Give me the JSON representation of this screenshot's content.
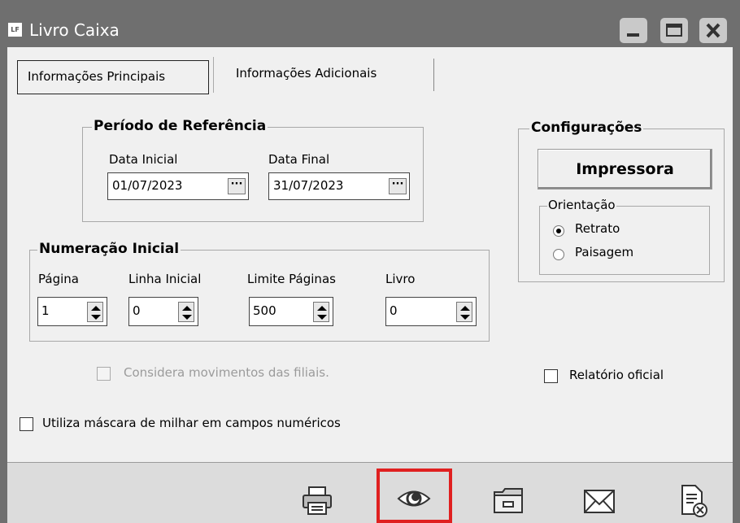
{
  "window": {
    "title": "Livro Caixa",
    "app_icon": "LF"
  },
  "tabs": [
    {
      "label": "Informações Principais",
      "active": true
    },
    {
      "label": "Informações Adicionais",
      "active": false
    }
  ],
  "periodo": {
    "legend": "Período de Referência",
    "data_inicial_label": "Data Inicial",
    "data_inicial": "01/07/2023",
    "data_final_label": "Data Final",
    "data_final": "31/07/2023",
    "picker_label": "···"
  },
  "numeracao": {
    "legend": "Numeração Inicial",
    "fields": [
      {
        "label": "Página",
        "value": "1"
      },
      {
        "label": "Linha Inicial",
        "value": "0"
      },
      {
        "label": "Limite Páginas",
        "value": "500"
      },
      {
        "label": "Livro",
        "value": "0"
      }
    ]
  },
  "configuracoes": {
    "legend": "Configurações",
    "impressora_label": "Impressora",
    "orientacao_legend": "Orientação",
    "options": [
      {
        "label": "Retrato",
        "selected": true
      },
      {
        "label": "Paisagem",
        "selected": false
      }
    ]
  },
  "checkboxes": {
    "considera_filiais": {
      "label": "Considera movimentos das filiais.",
      "checked": false,
      "enabled": false
    },
    "relatorio_oficial": {
      "label": "Relatório oficial",
      "checked": false
    },
    "mascara_milhar": {
      "label": "Utiliza máscara de milhar em campos numéricos",
      "checked": false
    }
  },
  "footer": {
    "icons": [
      "printer-icon",
      "preview-eye-icon",
      "folder-icon",
      "mail-icon",
      "close-document-icon"
    ],
    "highlight_color": "#e02020"
  }
}
